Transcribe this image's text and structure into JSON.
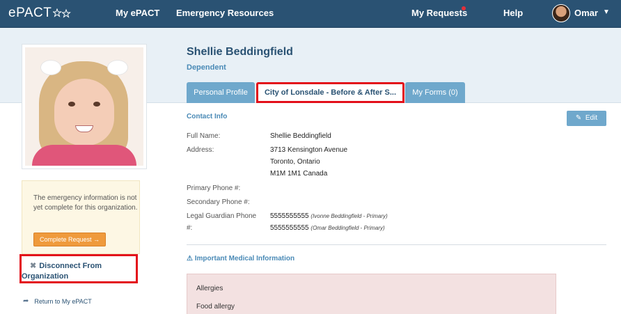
{
  "nav": {
    "logo": "ePACT",
    "links": [
      "My ePACT",
      "Emergency Resources"
    ],
    "my_requests": "My Requests",
    "help": "Help",
    "user": "Omar"
  },
  "profile": {
    "name": "Shellie Beddingfield",
    "role": "Dependent"
  },
  "tabs": [
    {
      "label": "Personal Profile",
      "active": false
    },
    {
      "label": "City of Lonsdale - Before & After S...",
      "active": true
    },
    {
      "label": "My Forms (0)",
      "active": false
    }
  ],
  "sidebar": {
    "warning": "The emergency information is not yet complete for this organization.",
    "complete_button": "Complete Request →",
    "disconnect_line1": "Disconnect From",
    "disconnect_line2": "Organization",
    "return_link": "Return to My ePACT"
  },
  "contact": {
    "title": "Contact Info",
    "edit_label": "Edit",
    "full_name_label": "Full Name:",
    "full_name": "Shellie Beddingfield",
    "address_label": "Address:",
    "address_line1": "3713 Kensington Avenue",
    "address_line2": "Toronto, Ontario",
    "address_line3": "M1M 1M1 Canada",
    "primary_phone_label": "Primary Phone #:",
    "secondary_phone_label": "Secondary Phone #:",
    "guardian_label_line1": "Legal Guardian Phone",
    "guardian_label_line2": "#:",
    "guardian_phones": [
      {
        "number": "5555555555",
        "note": "(Ivonne Beddingfield - Primary)"
      },
      {
        "number": "5555555555",
        "note": "(Omar Beddingfield - Primary)"
      }
    ]
  },
  "medical": {
    "title": "Important Medical Information",
    "items": [
      "Allergies",
      "Food allergy"
    ]
  },
  "colors": {
    "nav_bg": "#2a5273",
    "accent": "#4a8ab6",
    "tab_bg": "#6fa8cc",
    "highlight": "#e3101a",
    "warning_bg": "#fdf7e4",
    "button_orange": "#ef9a3c",
    "medical_bg": "#f3e1e1"
  }
}
